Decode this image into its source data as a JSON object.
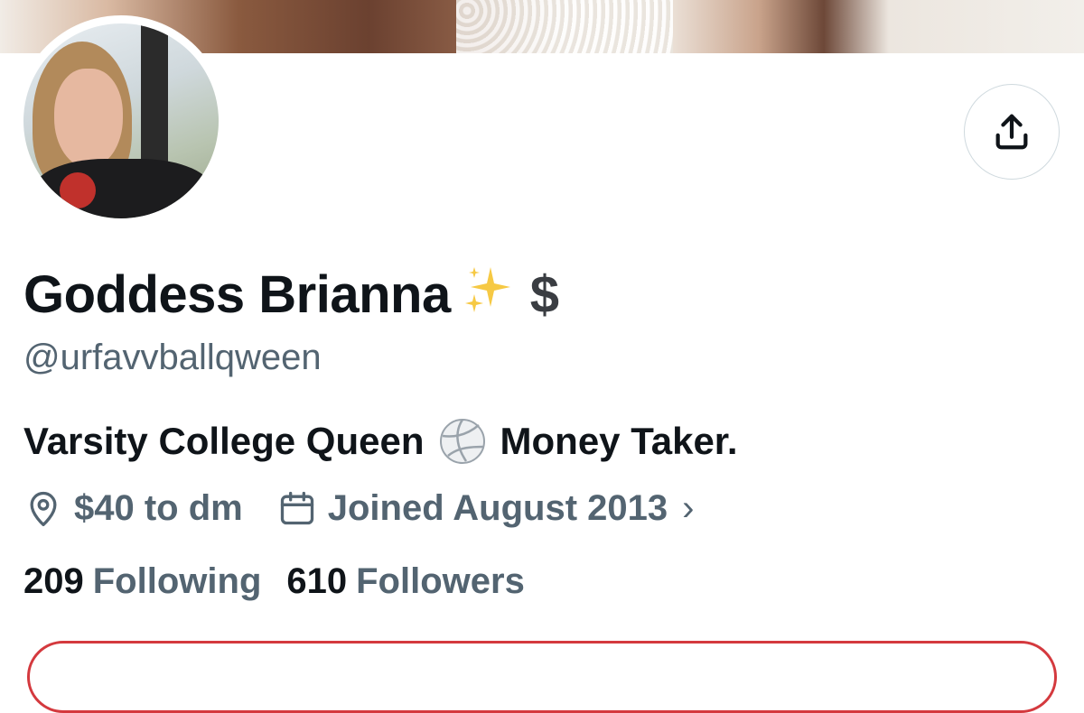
{
  "profile": {
    "display_name": "Goddess Brianna",
    "name_emoji": "✨",
    "name_symbol": "$",
    "handle": "@urfavvballqween",
    "bio_part1": "Varsity College Queen",
    "bio_emoji": "🏐",
    "bio_part2": "Money Taker.",
    "location": "$40 to dm",
    "joined": "Joined August 2013",
    "joined_chevron": "›"
  },
  "stats": {
    "following_count": "209",
    "following_label": "Following",
    "followers_count": "610",
    "followers_label": "Followers"
  },
  "icons": {
    "share": "share-icon",
    "location": "location-pin-icon",
    "calendar": "calendar-icon"
  },
  "colors": {
    "text_primary": "#0f1419",
    "text_secondary": "#536471",
    "border": "#cfd9de",
    "button_border": "#d4393e"
  }
}
